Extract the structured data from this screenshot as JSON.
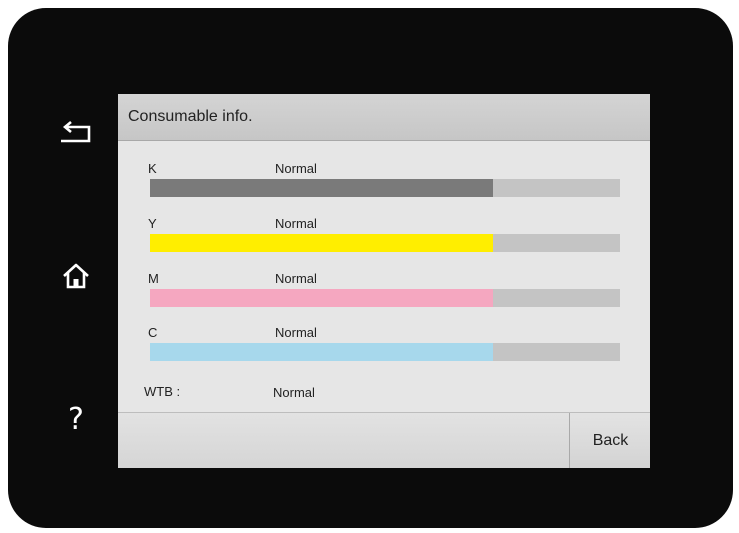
{
  "title": "Consumable info.",
  "side_buttons": {
    "back_icon": "back-arrow-icon",
    "home_icon": "home-icon",
    "help_glyph": "?"
  },
  "consumables": [
    {
      "name": "K",
      "status": "Normal",
      "level_percent": 73,
      "color": "#7a7a7a"
    },
    {
      "name": "Y",
      "status": "Normal",
      "level_percent": 73,
      "color": "#ffee00"
    },
    {
      "name": "M",
      "status": "Normal",
      "level_percent": 73,
      "color": "#f5a7c0"
    },
    {
      "name": "C",
      "status": "Normal",
      "level_percent": 73,
      "color": "#a7d8ec"
    }
  ],
  "wtb": {
    "name": "WTB :",
    "status": "Normal"
  },
  "footer": {
    "back_label": "Back"
  },
  "colors": {
    "bezel": "#0b0b0b",
    "screen": "#e6e6e6",
    "track": "#c4c4c4"
  }
}
